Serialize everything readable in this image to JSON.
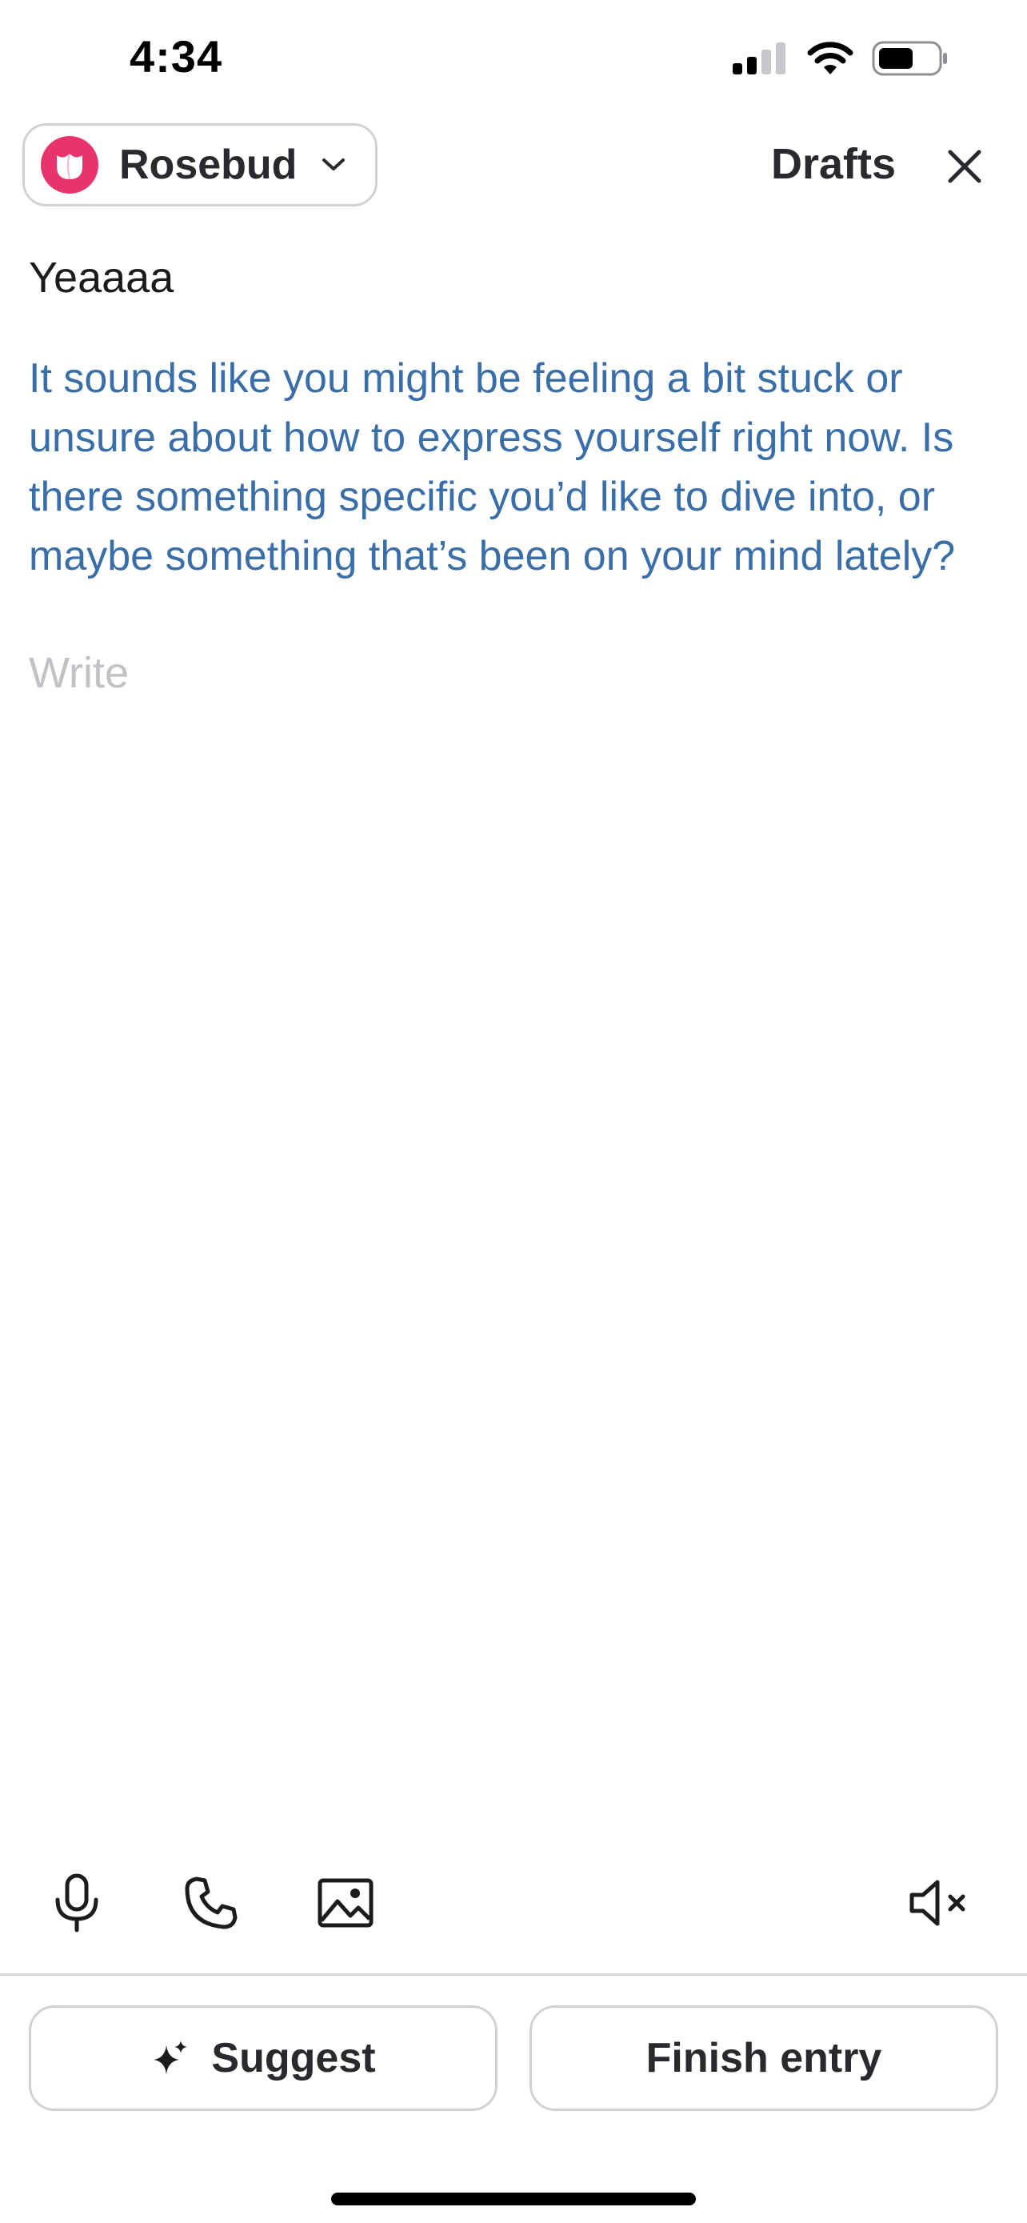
{
  "status_bar": {
    "time": "4:34",
    "signal_icon": "cellular-signal-icon",
    "wifi_icon": "wifi-icon",
    "battery_icon": "battery-icon",
    "battery_level": 0.55
  },
  "header": {
    "assistant_name": "Rosebud",
    "assistant_icon": "rose-icon",
    "drafts_label": "Drafts",
    "close_icon": "close-icon"
  },
  "entry": {
    "user_text": "Yeaaaa",
    "ai_response": "It sounds like you might be feeling a bit stuck or unsure about how to express yourself right now. Is there something specific you’d like to dive into, or maybe something that’s been on your mind lately?",
    "input_placeholder": "Write",
    "input_value": ""
  },
  "toolbar": {
    "microphone_icon": "microphone-icon",
    "phone_icon": "phone-icon",
    "image_icon": "image-icon",
    "mute_icon": "speaker-muted-icon"
  },
  "actions": {
    "suggest_label": "Suggest",
    "suggest_icon": "sparkle-icon",
    "finish_label": "Finish entry"
  },
  "colors": {
    "brand": "#e8346b",
    "ai_text": "#3a6ea8",
    "placeholder": "#c2c2c6",
    "border": "#d1d1d6"
  }
}
